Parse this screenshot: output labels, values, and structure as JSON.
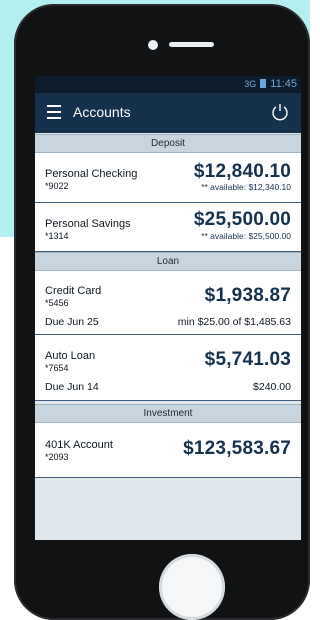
{
  "status": {
    "signal": "3G",
    "time": "11:45"
  },
  "header": {
    "title": "Accounts"
  },
  "sections": [
    {
      "label": "Deposit"
    },
    {
      "label": "Loan"
    },
    {
      "label": "Investment"
    }
  ],
  "accounts": {
    "checking": {
      "name": "Personal Checking",
      "number": "*9022",
      "balance": "$12,840.10",
      "available": "** available: $12,340.10"
    },
    "savings": {
      "name": "Personal Savings",
      "number": "*1314",
      "balance": "$25,500.00",
      "available": "** available: $25,500.00"
    },
    "credit": {
      "name": "Credit Card",
      "number": "*5456",
      "balance": "$1,938.87",
      "due": "Due Jun 25",
      "min": "min $25.00 of $1,485.63"
    },
    "auto": {
      "name": "Auto Loan",
      "number": "*7654",
      "balance": "$5,741.03",
      "due": "Due Jun 14",
      "min": "$240.00"
    },
    "k401": {
      "name": "401K Account",
      "number": "*2093",
      "balance": "$123,583.67"
    }
  },
  "colors": {
    "appbar": "#14314e",
    "amount": "#14314e",
    "section": "#c8d5df"
  }
}
